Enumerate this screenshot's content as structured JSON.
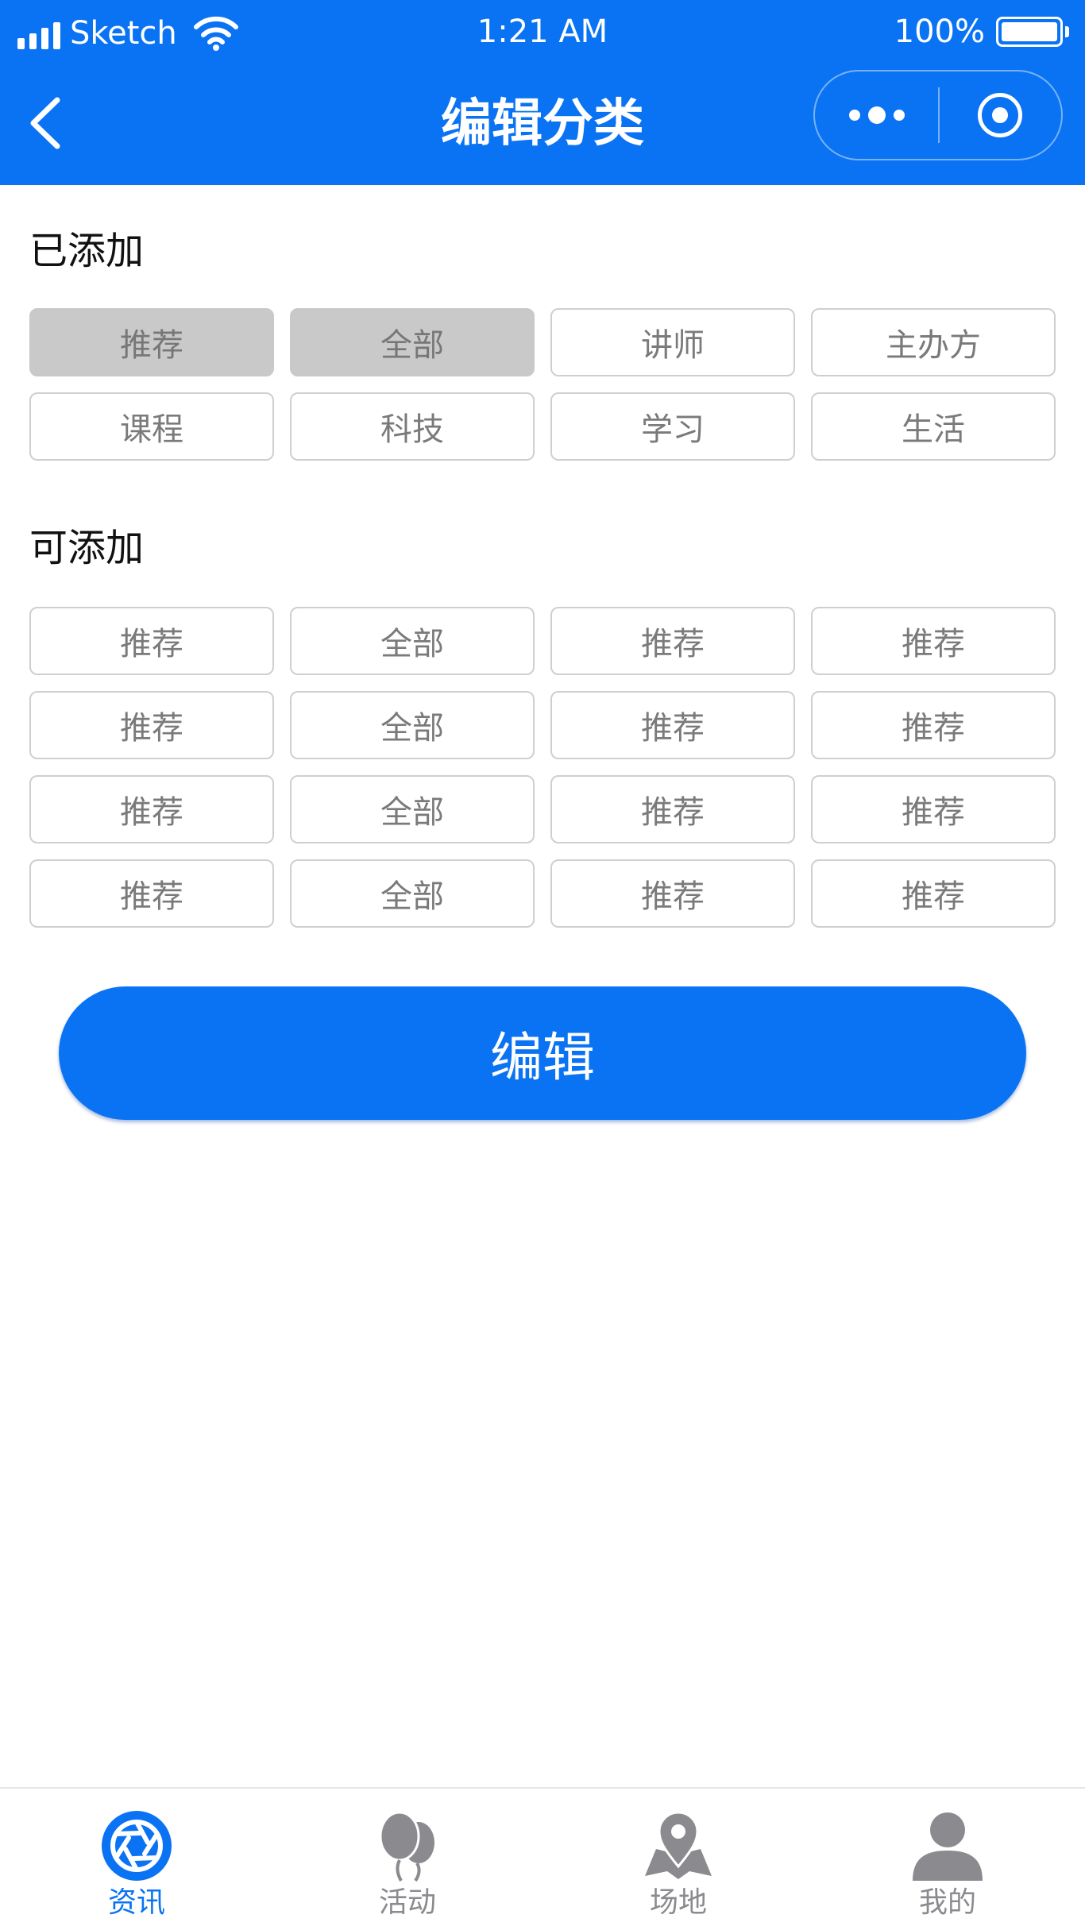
{
  "status_bar": {
    "carrier": "Sketch",
    "time": "1:21 AM",
    "battery": "100%"
  },
  "nav": {
    "title": "编辑分类"
  },
  "added_section": {
    "title": "已添加",
    "items": [
      "推荐",
      "全部",
      "讲师",
      "主办方",
      "课程",
      "科技",
      "学习",
      "生活"
    ],
    "fixed_count": 2
  },
  "available_section": {
    "title": "可添加",
    "items": [
      "推荐",
      "全部",
      "推荐",
      "推荐",
      "推荐",
      "全部",
      "推荐",
      "推荐",
      "推荐",
      "全部",
      "推荐",
      "推荐",
      "推荐",
      "全部",
      "推荐",
      "推荐"
    ]
  },
  "edit_button": {
    "label": "编辑"
  },
  "tabbar": {
    "active": "资讯",
    "tabs": [
      {
        "label": "资讯",
        "icon": "aperture-icon"
      },
      {
        "label": "活动",
        "icon": "balloons-icon"
      },
      {
        "label": "场地",
        "icon": "map-pin-icon"
      },
      {
        "label": "我的",
        "icon": "user-icon"
      }
    ]
  },
  "colors": {
    "primary": "#0A73F3",
    "tab_inactive": "#8A8A8F",
    "chip_fixed_bg": "#C9C9C9",
    "chip_border": "#CFCFCF"
  }
}
